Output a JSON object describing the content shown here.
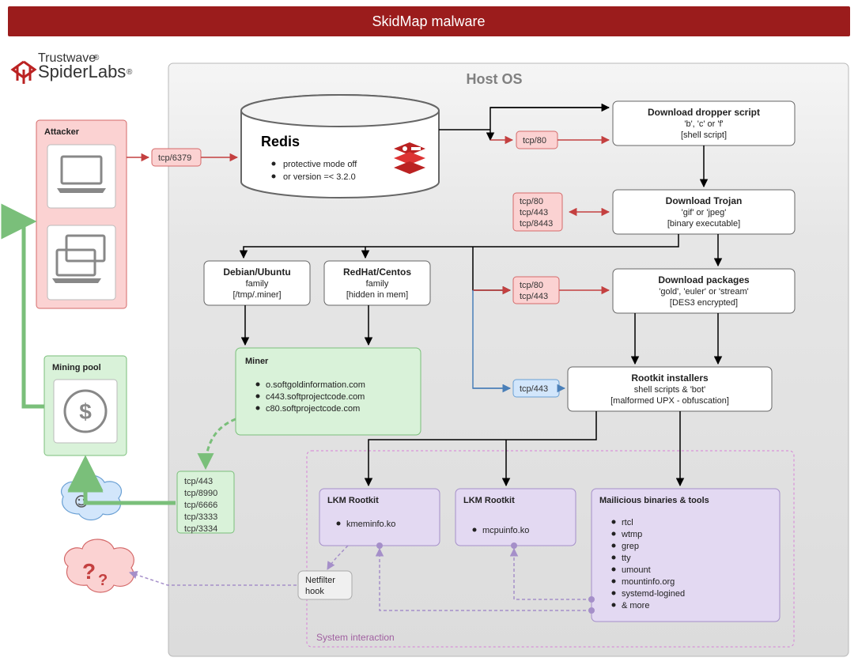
{
  "title": "SkidMap malware",
  "brand": {
    "line1": "Trustwave",
    "line2": "SpiderLabs"
  },
  "host_label": "Host OS",
  "attacker_label": "Attacker",
  "mining_pool_label": "Mining pool",
  "redis": {
    "name": "Redis",
    "bullet1": "protective mode off",
    "bullet2": "or version =< 3.2.0"
  },
  "ports": {
    "redis": "tcp/6379",
    "drop80": "tcp/80",
    "trojan1": "tcp/80",
    "trojan2": "tcp/443",
    "trojan3": "tcp/8443",
    "pkg1": "tcp/80",
    "pkg2": "tcp/443",
    "rootkit": "tcp/443",
    "miner1": "tcp/443",
    "miner2": "tcp/8990",
    "miner3": "tcp/6666",
    "miner4": "tcp/3333",
    "miner5": "tcp/3334"
  },
  "nodes": {
    "dropper1": "Download dropper script",
    "dropper2": "'b', 'c' or 'f'",
    "dropper3": "[shell script]",
    "trojanA": "Download Trojan",
    "trojanB": "'gif' or 'jpeg'",
    "trojanC": "[binary executable]",
    "pkgA": "Download packages",
    "pkgB": "'gold', 'euler' or 'stream'",
    "pkgC": "[DES3 encrypted]",
    "installA": "Rootkit installers",
    "installB": "shell scripts & 'bot'",
    "installC": "[malformed UPX - obfuscation]",
    "debianA": "Debian/Ubuntu",
    "debianB": "family",
    "debianC": "[/tmp/.miner]",
    "redhatA": "RedHat/Centos",
    "redhatB": "family",
    "redhatC": "[hidden in mem]"
  },
  "miner": {
    "title": "Miner",
    "d1": "o.softgoldinformation.com",
    "d2": "c443.softprojectcode.com",
    "d3": "c80.softprojectcode.com"
  },
  "lkm1": {
    "title": "LKM Rootkit",
    "item": "kmeminfo.ko"
  },
  "lkm2": {
    "title": "LKM Rootkit",
    "item": "mcpuinfo.ko"
  },
  "mal": {
    "title": "Mailicious binaries & tools",
    "i1": "rtcl",
    "i2": "wtmp",
    "i3": "grep",
    "i4": "tty",
    "i5": "umount",
    "i6": "mountinfo.org",
    "i7": "systemd-logined",
    "i8": "& more"
  },
  "netfilter1": "Netfilter",
  "netfilter2": "hook",
  "system_interaction": "System interaction",
  "question": "?"
}
